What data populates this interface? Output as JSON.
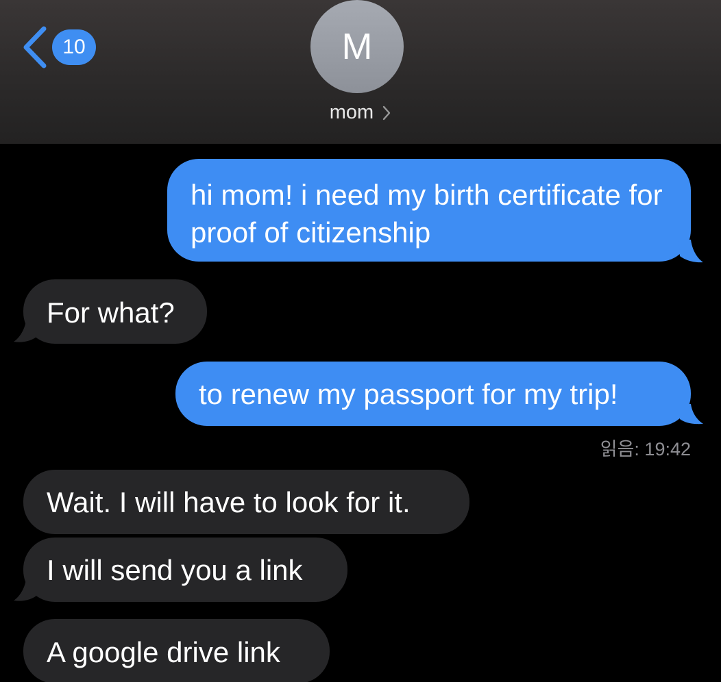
{
  "header": {
    "back_count": "10",
    "avatar_initial": "M",
    "contact_name": "mom"
  },
  "messages": [
    {
      "direction": "outgoing",
      "text": "hi mom! i need my birth certificate for proof of citizenship"
    },
    {
      "direction": "incoming",
      "text": "For what?"
    },
    {
      "direction": "outgoing",
      "text": "to renew my passport for my trip!"
    },
    {
      "direction": "incoming",
      "text": "Wait. I will have to look for it."
    },
    {
      "direction": "incoming",
      "text": "I will send you a link"
    },
    {
      "direction": "incoming",
      "text": "A google drive link"
    }
  ],
  "read_receipt": "읽음: 19:42",
  "colors": {
    "outgoing_bubble": "#3e8df3",
    "incoming_bubble": "#262628",
    "background": "#000000",
    "accent": "#3f8ef2"
  }
}
